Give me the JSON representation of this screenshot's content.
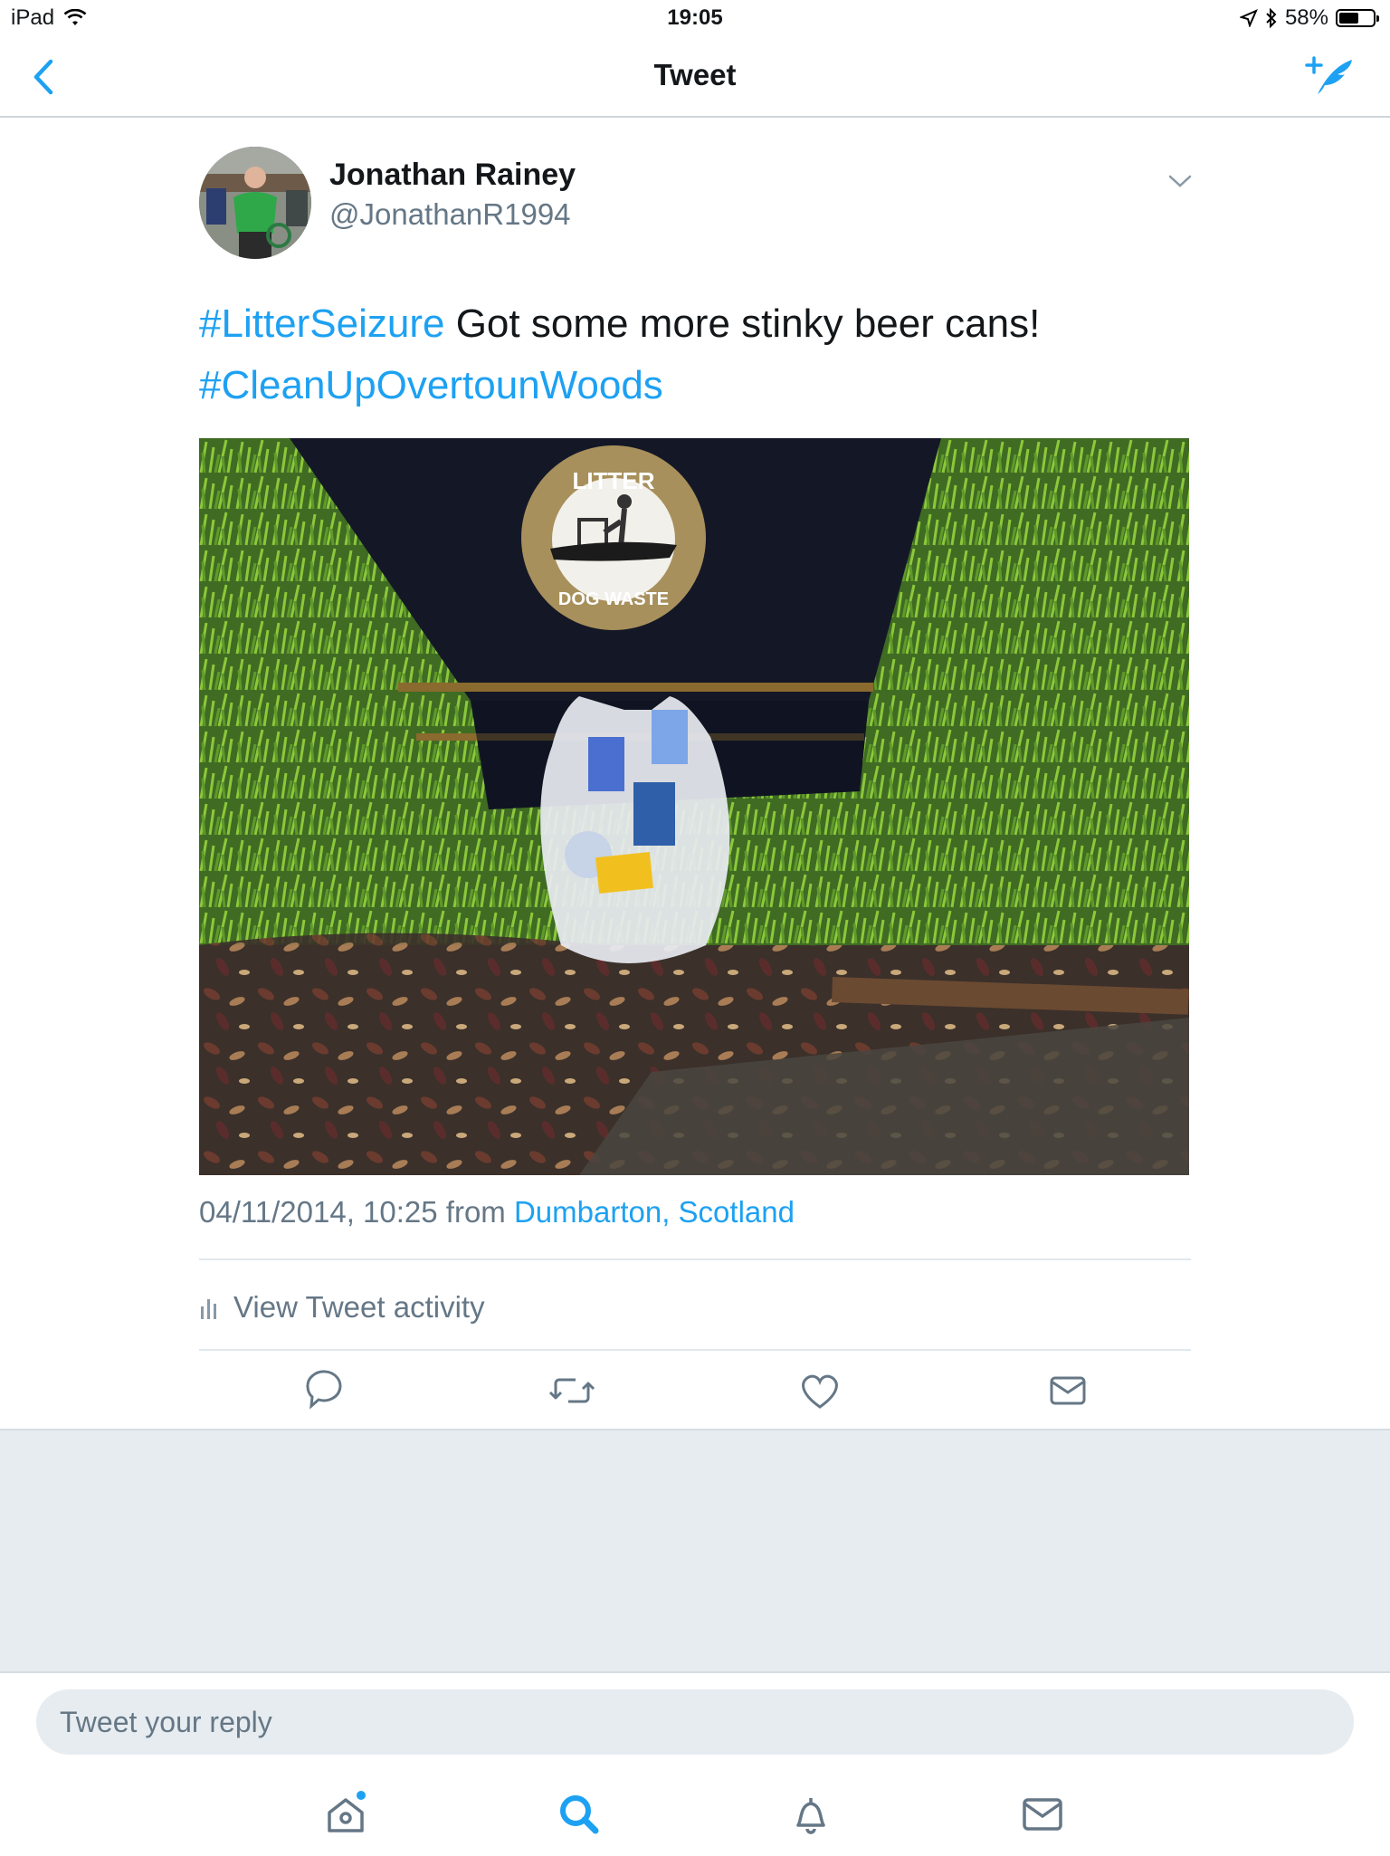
{
  "status_bar": {
    "device": "iPad",
    "time": "19:05",
    "battery": "58%",
    "battery_level": 0.58,
    "icons": [
      "wifi-icon",
      "location-arrow-icon",
      "bluetooth-icon",
      "battery-icon"
    ]
  },
  "nav": {
    "title": "Tweet",
    "back_icon": "chevron-left-icon",
    "compose_icon": "compose-tweet-icon"
  },
  "tweet": {
    "author_name": "Jonathan Rainey",
    "author_handle": "@JonathanR1994",
    "hashtag_1": "#LitterSeizure",
    "body_text": " Got some more stinky beer cans!",
    "hashtag_2": "#CleanUpOvertounWoods",
    "timestamp": "04/11/2014, 10:25 from ",
    "location": "Dumbarton, Scotland",
    "activity_label": "View Tweet activity"
  },
  "photo_sign": {
    "top_text": "LITTER",
    "bottom_text": "DOG WASTE"
  },
  "actions": [
    "reply-icon",
    "retweet-icon",
    "like-icon",
    "direct-message-icon"
  ],
  "reply": {
    "placeholder": "Tweet your reply"
  },
  "tabs": [
    "home-icon",
    "search-icon",
    "notifications-icon",
    "messages-icon"
  ],
  "colors": {
    "accent": "#1da1f2",
    "secondary_text": "#657786",
    "divider": "#e1e8ed",
    "background_grey": "#e6ecf0"
  }
}
